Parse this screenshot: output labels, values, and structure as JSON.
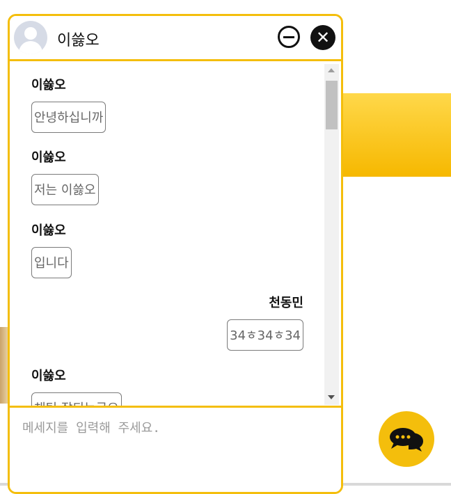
{
  "chat": {
    "title": "이쓿오",
    "minimize_icon": "minimize-icon",
    "close_icon": "close-icon",
    "close_glyph": "✕",
    "input_placeholder": "메세지를 입력해 주세요.",
    "messages": [
      {
        "sender": "이쓿오",
        "text": "안녕하십니까",
        "side": "left"
      },
      {
        "sender": "이쓿오",
        "text": "저는 이쓿오",
        "side": "left"
      },
      {
        "sender": "이쓿오",
        "text": "입니다",
        "side": "left"
      },
      {
        "sender": "천동민",
        "text": "34ㅎ34ㅎ34",
        "side": "right"
      },
      {
        "sender": "이쓿오",
        "text": "채팅 잘되는군요",
        "side": "left"
      }
    ]
  },
  "colors": {
    "accent": "#f4be0c",
    "bubble_border": "#7a7a7a",
    "text_muted": "#666666"
  },
  "chat_button": {
    "icon": "chat-bubbles-icon"
  }
}
